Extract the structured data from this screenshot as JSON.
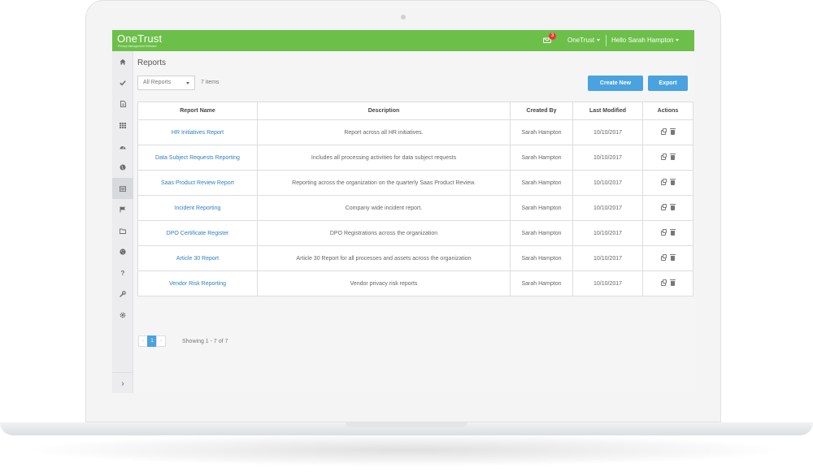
{
  "header": {
    "brand": "OneTrust",
    "brand_tagline": "Privacy Management Software",
    "notification_count": "3",
    "org_menu": "OneTrust",
    "user_menu": "Hello Sarah Hampton"
  },
  "sidebar": {
    "items": [
      {
        "icon": "home-icon"
      },
      {
        "icon": "check-icon"
      },
      {
        "icon": "document-icon"
      },
      {
        "icon": "grid-icon"
      },
      {
        "icon": "dashboard-icon"
      },
      {
        "icon": "globe-icon"
      },
      {
        "icon": "table-icon",
        "active": true
      },
      {
        "icon": "flag-icon"
      },
      {
        "icon": "folder-icon"
      },
      {
        "icon": "cookie-icon"
      },
      {
        "icon": "help-icon"
      },
      {
        "icon": "wrench-icon"
      },
      {
        "icon": "gear-icon"
      }
    ],
    "expand_icon": "chevron-right-icon"
  },
  "page": {
    "title": "Reports",
    "filter_value": "All Reports",
    "item_count": "7 items",
    "create_label": "Create New",
    "export_label": "Export"
  },
  "table": {
    "columns": [
      "Report Name",
      "Description",
      "Created By",
      "Last Modified",
      "Actions"
    ],
    "rows": [
      {
        "name": "HR Initiatives Report",
        "description": "Report across all HR initiatives.",
        "created_by": "Sarah Hampton",
        "modified": "10/10/2017"
      },
      {
        "name": "Data Subject Requests Reporting",
        "description": "Includes all processing activities for data subject requests",
        "created_by": "Sarah Hampton",
        "modified": "10/10/2017"
      },
      {
        "name": "Saas Product Review Report",
        "description": "Reporting across the organization on the quarterly Saas Product Review.",
        "created_by": "Sarah Hampton",
        "modified": "10/10/2017"
      },
      {
        "name": "Incident Reporting",
        "description": "Company wide incident report.",
        "created_by": "Sarah Hampton",
        "modified": "10/10/2017"
      },
      {
        "name": "DPO Certificate Register",
        "description": "DPO Registrations across the organization",
        "created_by": "Sarah Hampton",
        "modified": "10/10/2017"
      },
      {
        "name": "Article 30 Report",
        "description": "Article 30 Report for all processes and assets across the organization",
        "created_by": "Sarah Hampton",
        "modified": "10/10/2017"
      },
      {
        "name": "Vendor Risk Reporting",
        "description": "Vendor privacy risk reports",
        "created_by": "Sarah Hampton",
        "modified": "10/10/2017"
      }
    ]
  },
  "pagination": {
    "prev": "‹",
    "current_page": "1",
    "next": "›",
    "showing": "Showing 1 - 7 of 7"
  },
  "colors": {
    "header_green": "#6cc04a",
    "button_blue": "#4aa3df",
    "link_blue": "#2f7fc1",
    "badge_red": "#e53935"
  }
}
